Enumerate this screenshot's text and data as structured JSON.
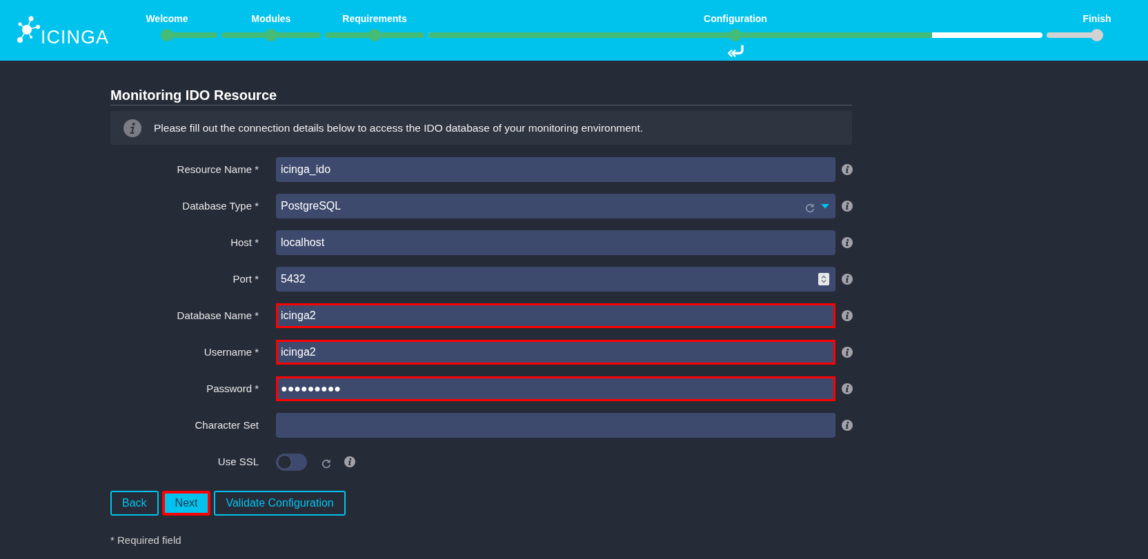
{
  "header": {
    "logo": {
      "text": "ICINGA"
    },
    "steps": [
      {
        "label": "Welcome",
        "reached": true,
        "current": false
      },
      {
        "label": "Modules",
        "reached": true,
        "current": false
      },
      {
        "label": "Requirements",
        "reached": true,
        "current": false
      },
      {
        "label": "Configuration",
        "reached": true,
        "current": true,
        "level": 0.82
      },
      {
        "label": "Finish",
        "reached": false,
        "current": false
      }
    ]
  },
  "form": {
    "title": "Monitoring IDO Resource",
    "notice": "Please fill out the connection details below to access the IDO database of your monitoring environment.",
    "fields": [
      {
        "label": "Resource Name *",
        "kind": "text",
        "value": "icinga_ido",
        "highlighted": false
      },
      {
        "label": "Database Type *",
        "kind": "select",
        "value": "PostgreSQL",
        "highlighted": false
      },
      {
        "label": "Host *",
        "kind": "text",
        "value": "localhost",
        "highlighted": false
      },
      {
        "label": "Port *",
        "kind": "number",
        "value": "5432",
        "highlighted": false
      },
      {
        "label": "Database Name *",
        "kind": "text",
        "value": "icinga2",
        "highlighted": true
      },
      {
        "label": "Username *",
        "kind": "text",
        "value": "icinga2",
        "highlighted": true
      },
      {
        "label": "Password *",
        "kind": "password",
        "value": "●●●●●●●●●",
        "highlighted": true
      },
      {
        "label": "Character Set",
        "kind": "text",
        "highlighted": false
      },
      {
        "label": "Use SSL",
        "kind": "toggle",
        "on": false,
        "highlighted": false
      }
    ],
    "buttons": [
      {
        "label": "Back",
        "kind": "outline",
        "highlighted": false
      },
      {
        "label": "Next",
        "kind": "primary",
        "highlighted": true
      },
      {
        "label": "Validate Configuration",
        "kind": "outline",
        "highlighted": false
      }
    ],
    "footnote": "* Required field"
  }
}
